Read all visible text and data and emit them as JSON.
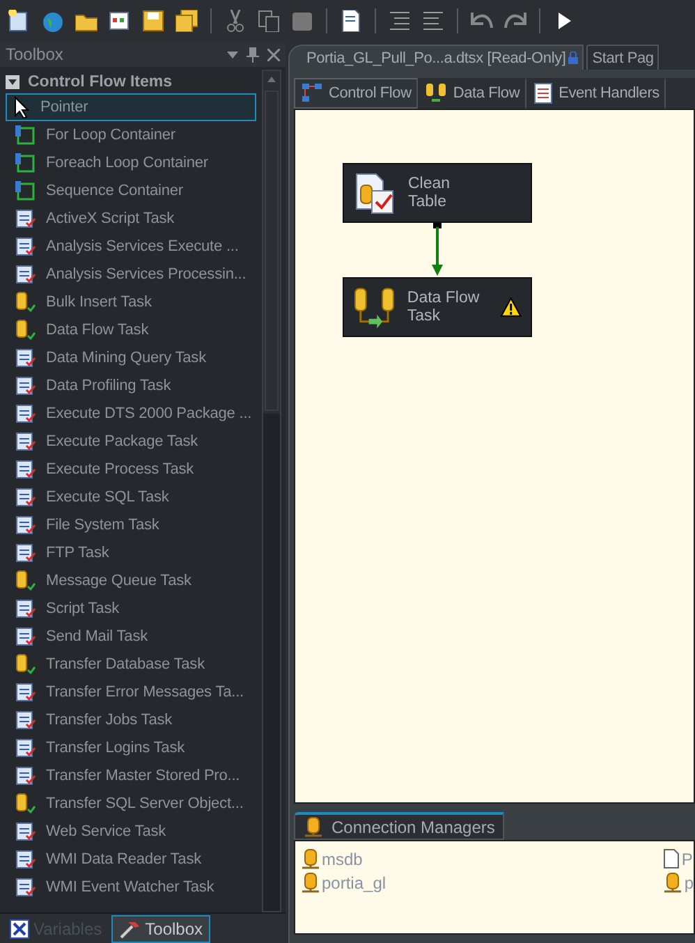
{
  "toolbox": {
    "title": "Toolbox",
    "group": {
      "label": "Control Flow Items",
      "expanded": true
    },
    "items": [
      {
        "label": "Pointer",
        "kind": "pointer",
        "selected": true
      },
      {
        "label": "For Loop Container",
        "kind": "container",
        "selected": false
      },
      {
        "label": "Foreach Loop Container",
        "kind": "container",
        "selected": false
      },
      {
        "label": "Sequence Container",
        "kind": "container",
        "selected": false
      },
      {
        "label": "ActiveX Script Task",
        "kind": "task",
        "selected": false
      },
      {
        "label": "Analysis Services Execute ...",
        "kind": "task",
        "selected": false
      },
      {
        "label": "Analysis Services Processin...",
        "kind": "task",
        "selected": false
      },
      {
        "label": "Bulk Insert Task",
        "kind": "database",
        "selected": false
      },
      {
        "label": "Data Flow Task",
        "kind": "database",
        "selected": false
      },
      {
        "label": "Data Mining Query Task",
        "kind": "task",
        "selected": false
      },
      {
        "label": "Data Profiling Task",
        "kind": "task",
        "selected": false
      },
      {
        "label": "Execute DTS 2000 Package ...",
        "kind": "task",
        "selected": false
      },
      {
        "label": "Execute Package Task",
        "kind": "task",
        "selected": false
      },
      {
        "label": "Execute Process Task",
        "kind": "task",
        "selected": false
      },
      {
        "label": "Execute SQL Task",
        "kind": "task",
        "selected": false
      },
      {
        "label": "File System Task",
        "kind": "task",
        "selected": false
      },
      {
        "label": "FTP Task",
        "kind": "task",
        "selected": false
      },
      {
        "label": "Message Queue Task",
        "kind": "database",
        "selected": false
      },
      {
        "label": "Script Task",
        "kind": "task",
        "selected": false
      },
      {
        "label": "Send Mail Task",
        "kind": "task",
        "selected": false
      },
      {
        "label": "Transfer Database Task",
        "kind": "database",
        "selected": false
      },
      {
        "label": "Transfer Error Messages Ta...",
        "kind": "task",
        "selected": false
      },
      {
        "label": "Transfer Jobs Task",
        "kind": "task",
        "selected": false
      },
      {
        "label": "Transfer Logins Task",
        "kind": "task",
        "selected": false
      },
      {
        "label": "Transfer Master Stored Pro...",
        "kind": "task",
        "selected": false
      },
      {
        "label": "Transfer SQL Server Object...",
        "kind": "database",
        "selected": false
      },
      {
        "label": "Web Service Task",
        "kind": "task",
        "selected": false
      },
      {
        "label": "WMI Data Reader Task",
        "kind": "task",
        "selected": false
      },
      {
        "label": "WMI Event Watcher Task",
        "kind": "task",
        "selected": false
      }
    ],
    "bottom_tabs": [
      {
        "label": "Variables",
        "selected": false
      },
      {
        "label": "Toolbox",
        "selected": true
      }
    ]
  },
  "document_tabs": [
    {
      "label": "Portia_GL_Pull_Po...a.dtsx [Read-Only]",
      "selected": true
    },
    {
      "label": "Start Pag",
      "selected": false
    }
  ],
  "designer_tabs": [
    {
      "label": "Control Flow",
      "selected": true
    },
    {
      "label": "Data Flow",
      "selected": false
    },
    {
      "label": "Event Handlers",
      "selected": false
    }
  ],
  "canvas": {
    "tasks": [
      {
        "label": "Clean Table",
        "kind": "sql",
        "warning": false
      },
      {
        "label": "Data Flow Task",
        "kind": "dataflow",
        "warning": true
      }
    ]
  },
  "connection_managers": {
    "title": "Connection Managers",
    "items": [
      {
        "label": "msdb",
        "kind": "database"
      },
      {
        "label": "portia_gl",
        "kind": "database"
      },
      {
        "label": "P",
        "kind": "file"
      },
      {
        "label": "p",
        "kind": "database"
      }
    ]
  }
}
